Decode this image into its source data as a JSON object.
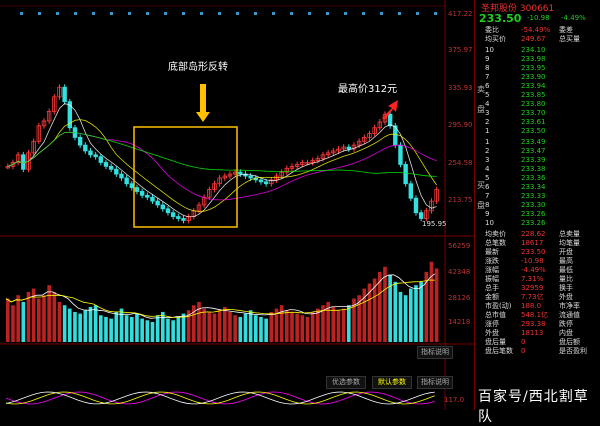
{
  "header": {
    "stock_code_partial": "300661",
    "stock_name_partial": "圣邦股份",
    "last_price": "233.50",
    "change": "-10.98",
    "change_pct": "-4.49%"
  },
  "price_axis_ticks": [
    "417.22",
    "375.97",
    "335.93",
    "295.90",
    "254.58",
    "213.75"
  ],
  "volume_axis_ticks": [
    "56259",
    "42348",
    "28126",
    "14218"
  ],
  "annotations": {
    "island_reversal": "底部岛形反转",
    "high_price": "最高价312元",
    "low_marker": "195.95"
  },
  "chart_data": {
    "type": "candlestick",
    "title": "",
    "price_range": [
      190,
      420
    ],
    "volume_range": [
      0,
      56259
    ],
    "approx_series_note_excluded": true,
    "candles_close": [
      258,
      262,
      270,
      255,
      272,
      284,
      300,
      305,
      315,
      330,
      340,
      325,
      298,
      288,
      280,
      274,
      270,
      268,
      262,
      258,
      255,
      250,
      246,
      240,
      236,
      232,
      228,
      226,
      222,
      218,
      214,
      210,
      206,
      204,
      202,
      206,
      212,
      218,
      226,
      234,
      240,
      246,
      248,
      250,
      252,
      250,
      248,
      246,
      244,
      242,
      240,
      244,
      248,
      252,
      256,
      258,
      260,
      262,
      262,
      264,
      266,
      270,
      272,
      274,
      276,
      278,
      276,
      280,
      284,
      288,
      292,
      298,
      304,
      312,
      300,
      280,
      260,
      240,
      225,
      210,
      204,
      212,
      222,
      234
    ],
    "volume": [
      26000,
      22000,
      28000,
      24000,
      30000,
      32000,
      26000,
      28000,
      34000,
      30000,
      24000,
      22000,
      20000,
      18000,
      17000,
      19000,
      21000,
      22000,
      16000,
      15000,
      14000,
      18000,
      20000,
      16000,
      15000,
      17000,
      14000,
      13000,
      12000,
      16000,
      18000,
      14000,
      13000,
      15000,
      17000,
      19000,
      22000,
      24000,
      20000,
      18000,
      17000,
      19000,
      21000,
      18000,
      16000,
      15000,
      17000,
      19000,
      16000,
      15000,
      14000,
      18000,
      20000,
      22000,
      19000,
      18000,
      17000,
      16000,
      15000,
      18000,
      20000,
      22000,
      24000,
      21000,
      19000,
      20000,
      22000,
      26000,
      28000,
      32000,
      35000,
      38000,
      42000,
      45000,
      40000,
      36000,
      30000,
      28000,
      32000,
      34000,
      36000,
      42000,
      48000,
      44000
    ]
  },
  "order_book": {
    "header_rows": [
      {
        "label": "委比",
        "value": "-54.49%",
        "extra": "委差"
      },
      {
        "label": "均买价",
        "value": "249.67",
        "extra": "总买量"
      }
    ],
    "sell_label": "卖盘",
    "buy_label": "买盘",
    "asks": [
      {
        "level": "10",
        "price": "234.10"
      },
      {
        "level": "9",
        "price": "233.98"
      },
      {
        "level": "8",
        "price": "233.95"
      },
      {
        "level": "7",
        "price": "233.90"
      },
      {
        "level": "6",
        "price": "233.94"
      },
      {
        "level": "5",
        "price": "233.85"
      },
      {
        "level": "4",
        "price": "233.80"
      },
      {
        "level": "3",
        "price": "233.70"
      },
      {
        "level": "2",
        "price": "233.61"
      },
      {
        "level": "1",
        "price": "233.50"
      }
    ],
    "bids": [
      {
        "level": "1",
        "price": "233.49"
      },
      {
        "level": "2",
        "price": "233.47"
      },
      {
        "level": "3",
        "price": "233.39"
      },
      {
        "level": "4",
        "price": "233.38"
      },
      {
        "level": "5",
        "price": "233.36"
      },
      {
        "level": "6",
        "price": "233.34"
      },
      {
        "level": "7",
        "price": "233.33"
      },
      {
        "level": "8",
        "price": "233.30"
      },
      {
        "level": "9",
        "price": "233.26"
      },
      {
        "level": "10",
        "price": "233.26"
      }
    ],
    "summary_rows": [
      {
        "label": "均卖价",
        "value": "228.62",
        "extra": "总卖量"
      },
      {
        "label": "总笔数",
        "value": "18617",
        "extra": "均笔量"
      },
      {
        "label": "最新",
        "value": "233.50",
        "extra": "开盘"
      },
      {
        "label": "涨跌",
        "value": "-10.98",
        "extra": "最高"
      },
      {
        "label": "涨幅",
        "value": "-4.49%",
        "extra": "最低"
      },
      {
        "label": "振幅",
        "value": "7.31%",
        "extra": "量比"
      },
      {
        "label": "总手",
        "value": "32959",
        "extra": "换手"
      },
      {
        "label": "金额",
        "value": "7.73亿",
        "extra": "外盘"
      },
      {
        "label": "市盈(动)",
        "value": "188.0",
        "extra": "市净率"
      },
      {
        "label": "总市值",
        "value": "548.1亿",
        "extra": "流通值"
      },
      {
        "label": "涨停",
        "value": "293.38",
        "extra": "跌停"
      },
      {
        "label": "外盘",
        "value": "18113",
        "extra": "内盘"
      },
      {
        "label": "盘后量",
        "value": "0",
        "extra": "盘后额"
      },
      {
        "label": "盘后笔数",
        "value": "0",
        "extra": "是否盈利"
      }
    ]
  },
  "indicator_buttons": {
    "label_1": "指标说明",
    "label_2": "指标说明",
    "tab_1": "优选参数",
    "tab_2": "默认参数",
    "tab_3": "指标说明",
    "sub_axis": "117.0"
  },
  "watermark": "百家号/西北割草队",
  "colors": {
    "up": "#ff3b3b",
    "down": "#33e0e0",
    "highlight_box": "#ffc000",
    "arrow": "#ffc000",
    "bg": "#000000"
  }
}
